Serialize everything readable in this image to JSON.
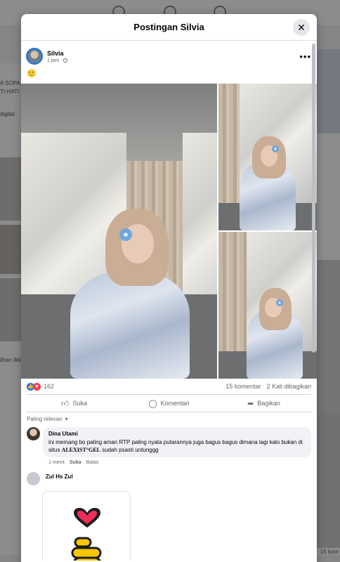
{
  "background": {
    "left_snippets": [
      "A SOPA",
      "TI-HATI",
      "digital",
      "lihan Iklan"
    ],
    "right_snippets": [
      "15 kom"
    ]
  },
  "modal": {
    "title": "Postingan Silvia",
    "close_icon": "close-icon"
  },
  "post": {
    "author": "Silvia",
    "time": "1 jam",
    "audience_icon": "globe-icon",
    "text": "🙂",
    "photo_count": 3
  },
  "stats": {
    "reactions_count": "162",
    "comments": "15 komentar",
    "shares": "2 Kali dibagikan"
  },
  "actions": {
    "like": "Suka",
    "comment": "Komentari",
    "share": "Bagikan"
  },
  "comments_filter": "Paling relevan",
  "comments": [
    {
      "name": "Dina Utami",
      "text_before": "ini memang bo paling aman RTP paling nyata putarannya juga bagus bagus dimana lagi kalo bukan di situs ",
      "text_brand": "ALEXIST°GEL",
      "text_after": " sudah psasti untunggg",
      "time": "1 menit",
      "like": "Suka",
      "reply": "Balas"
    },
    {
      "name": "Zul Hs Zul"
    }
  ],
  "colors": {
    "accent": "#1b74e4",
    "love": "#f33e58",
    "secondary_text": "#65676b"
  }
}
